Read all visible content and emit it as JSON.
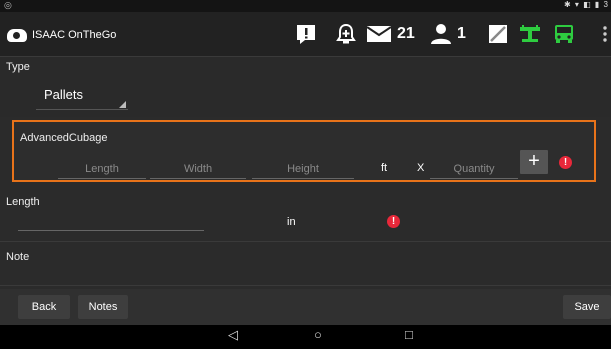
{
  "status": {
    "left_icon": "camera-icon",
    "right_icons": "✱ ▾ ◧ ▮ 3"
  },
  "app": {
    "title": "ISAAC OnTheGo"
  },
  "actions": {
    "alert_glyph": "!",
    "messages_count": "21",
    "people_count": "1"
  },
  "colors": {
    "accent_orange": "#e8731a",
    "error_red": "#e8283a",
    "green": "#2ecc40"
  },
  "type": {
    "label": "Type",
    "value": "Pallets"
  },
  "cubage": {
    "label": "AdvancedCubage",
    "length_placeholder": "Length",
    "width_placeholder": "Width",
    "height_placeholder": "Height",
    "unit": "ft",
    "times": "X",
    "quantity_placeholder": "Quantity",
    "add_glyph": "+",
    "error_glyph": "!"
  },
  "length": {
    "label": "Length",
    "unit": "in",
    "error_glyph": "!"
  },
  "note": {
    "label": "Note"
  },
  "buttons": {
    "back": "Back",
    "notes": "Notes",
    "save": "Save"
  },
  "nav": {
    "back": "◁",
    "home": "○",
    "recents": "□"
  }
}
